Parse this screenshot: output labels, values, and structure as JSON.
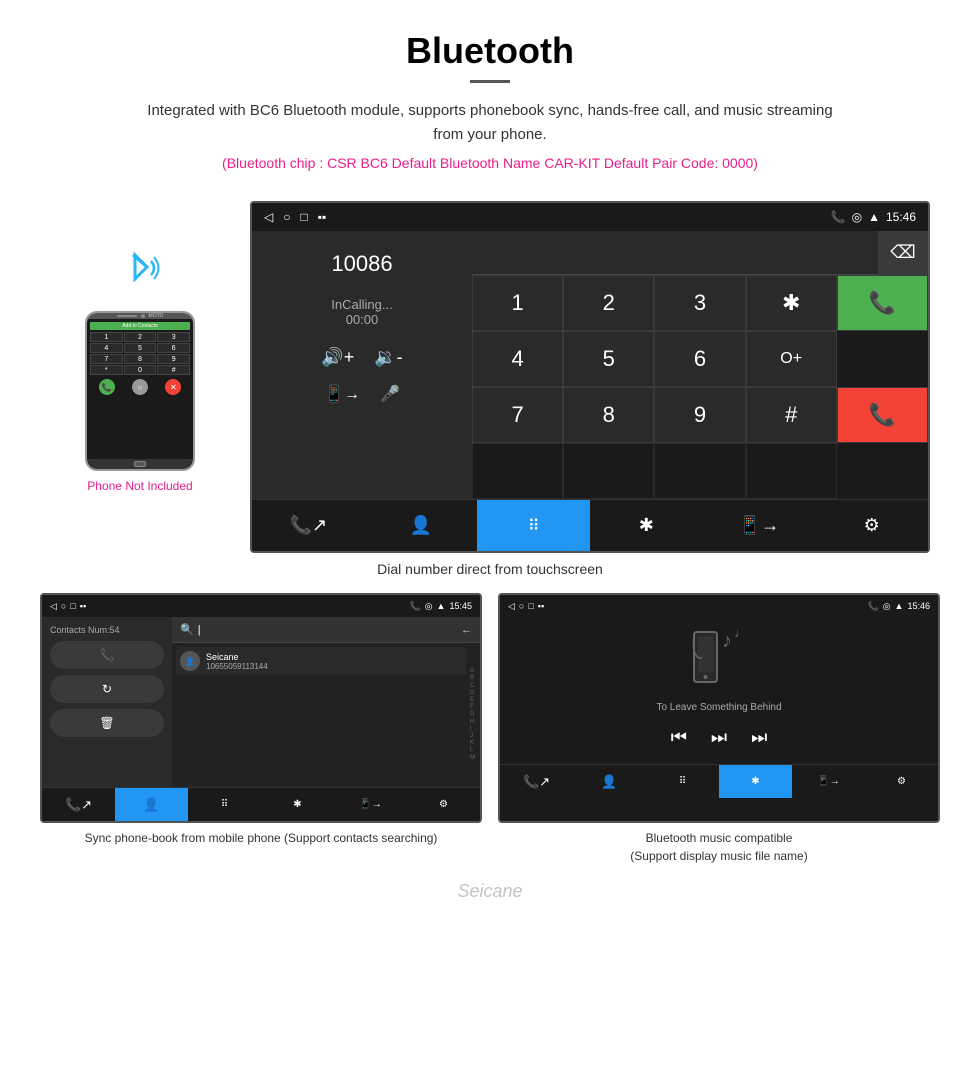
{
  "header": {
    "title": "Bluetooth",
    "description": "Integrated with BC6 Bluetooth module, supports phonebook sync, hands-free call, and music streaming from your phone.",
    "specs": "(Bluetooth chip : CSR BC6    Default Bluetooth Name CAR-KIT    Default Pair Code: 0000)"
  },
  "phone_mockup": {
    "not_included_label": "Phone Not Included",
    "bluetooth_icon": "((·))",
    "add_contacts_label": "Add to Contacts"
  },
  "main_dial_screen": {
    "status_time": "15:46",
    "dialed_number": "10086",
    "call_status": "InCalling...",
    "call_timer": "00:00",
    "keypad": [
      "1",
      "2",
      "3",
      "*",
      "4",
      "5",
      "6",
      "0+",
      "7",
      "8",
      "9",
      "#"
    ],
    "caption": "Dial number direct from touchscreen"
  },
  "contacts_screen": {
    "status_time": "15:45",
    "contacts_count": "Contacts Num:54",
    "contact_name": "Seicane",
    "contact_number": "10655059113144",
    "search_placeholder": "Search",
    "alphabet": [
      "A",
      "B",
      "C",
      "D",
      "E",
      "F",
      "G",
      "H",
      "I",
      "J",
      "K",
      "L",
      "M"
    ]
  },
  "music_screen": {
    "status_time": "15:46",
    "song_title": "To Leave Something Behind"
  },
  "captions": {
    "phonebook": "Sync phone-book from mobile phone\n(Support contacts searching)",
    "music": "Bluetooth music compatible\n(Support display music file name)"
  },
  "watermark": "Seicane"
}
